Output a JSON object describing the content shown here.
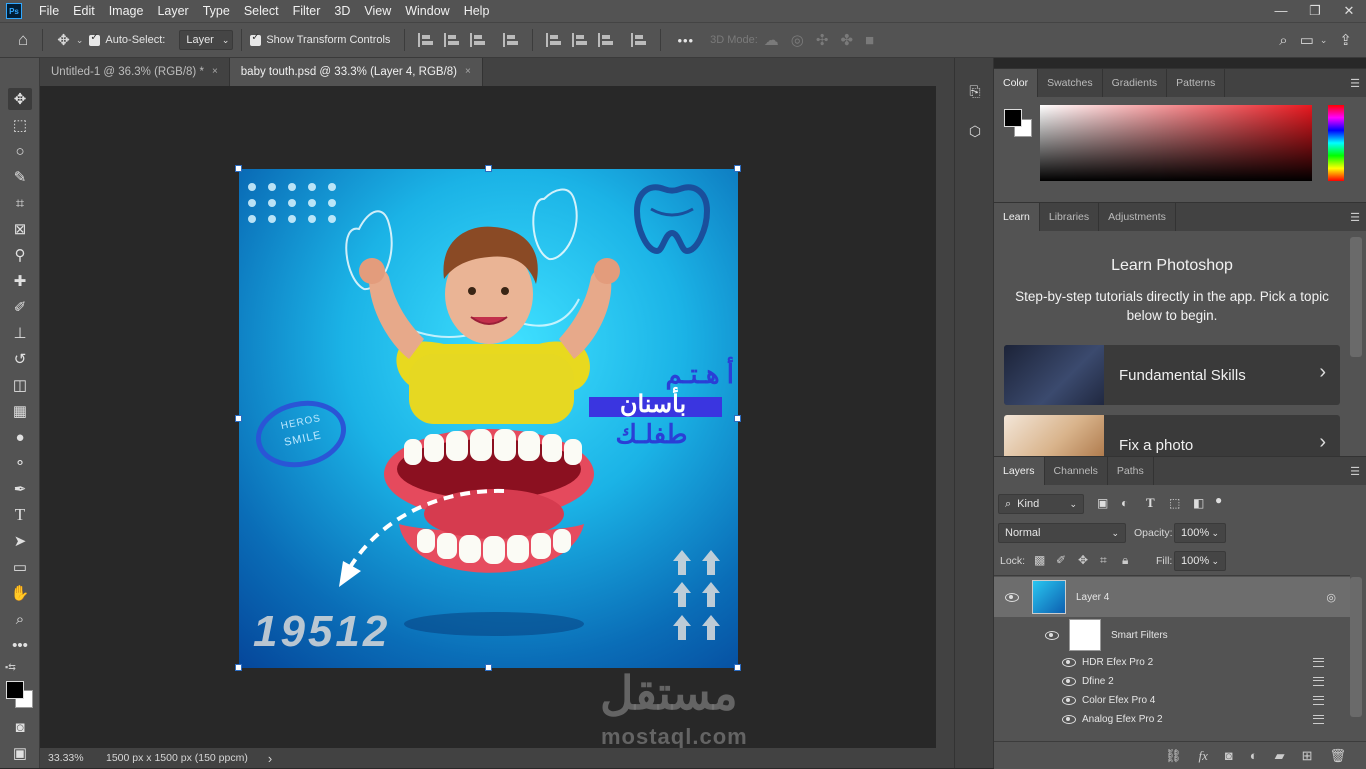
{
  "app": {
    "logo": "Ps"
  },
  "menu": [
    "File",
    "Edit",
    "Image",
    "Layer",
    "Type",
    "Select",
    "Filter",
    "3D",
    "View",
    "Window",
    "Help"
  ],
  "window_controls": {
    "minimize": "—",
    "restore": "❐",
    "close": "✕"
  },
  "options": {
    "auto_select_label": "Auto-Select:",
    "auto_select_target": "Layer",
    "show_transform_label": "Show Transform Controls",
    "more": "•••",
    "mode_3d_label": "3D Mode:"
  },
  "tabs": [
    {
      "label": "Untitled-1 @ 36.3% (RGB/8) *",
      "active": false
    },
    {
      "label": "baby touth.psd @ 33.3% (Layer 4, RGB/8)",
      "active": true
    }
  ],
  "tab_close": "×",
  "artwork": {
    "arabic_line1": "أ هـتـم",
    "arabic_line2": "بأسنان",
    "arabic_line3": "طفلـك",
    "badge_line1": "HEROS",
    "badge_line2": "SMILE",
    "phone": "19512"
  },
  "status": {
    "zoom": "33.33%",
    "doc_info": "1500 px x 1500 px (150 ppcm)",
    "arrow": "›"
  },
  "color_panel": {
    "tabs": [
      "Color",
      "Swatches",
      "Gradients",
      "Patterns"
    ],
    "foreground": "#000000",
    "background": "#ffffff",
    "hue": "#e8181f"
  },
  "learn_panel": {
    "tabs": [
      "Learn",
      "Libraries",
      "Adjustments"
    ],
    "title": "Learn Photoshop",
    "subtitle": "Step-by-step tutorials directly in the app. Pick a topic below to begin.",
    "cards": [
      {
        "label": "Fundamental Skills"
      },
      {
        "label": "Fix a photo"
      }
    ]
  },
  "layers_panel": {
    "tabs": [
      "Layers",
      "Channels",
      "Paths"
    ],
    "filter_kind": "Kind",
    "blend_mode": "Normal",
    "opacity_label": "Opacity:",
    "opacity_value": "100%",
    "lock_label": "Lock:",
    "fill_label": "Fill:",
    "fill_value": "100%",
    "layer_name": "Layer 4",
    "smart_filters_label": "Smart Filters",
    "filters": [
      "HDR Efex Pro 2",
      "Dfine 2",
      "Color Efex Pro 4",
      "Analog Efex Pro 2"
    ]
  },
  "watermark": {
    "arabic": "مستقل",
    "latin": "mostaql.com"
  }
}
